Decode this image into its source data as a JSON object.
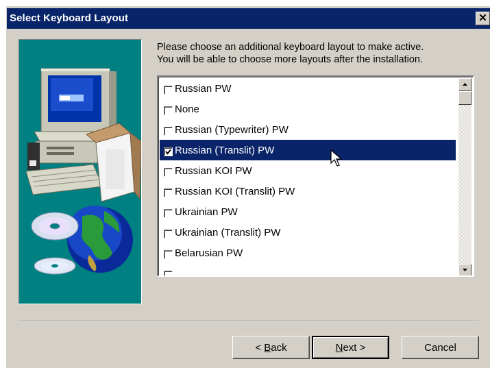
{
  "window": {
    "title": "Select Keyboard Layout",
    "close_glyph": "✕"
  },
  "instructions": {
    "line1": "Please choose an additional keyboard layout to make active.",
    "line2": "You will be able to choose more layouts after the installation."
  },
  "layouts": [
    {
      "label": "Russian PW",
      "checked": false,
      "selected": false
    },
    {
      "label": "None",
      "checked": false,
      "selected": false
    },
    {
      "label": "Russian (Typewriter) PW",
      "checked": false,
      "selected": false
    },
    {
      "label": "Russian (Translit) PW",
      "checked": true,
      "selected": true
    },
    {
      "label": "Russian KOI PW",
      "checked": false,
      "selected": false
    },
    {
      "label": "Russian KOI (Translit) PW",
      "checked": false,
      "selected": false
    },
    {
      "label": "Ukrainian PW",
      "checked": false,
      "selected": false
    },
    {
      "label": "Ukrainian (Translit) PW",
      "checked": false,
      "selected": false
    },
    {
      "label": "Belarusian PW",
      "checked": false,
      "selected": false
    },
    {
      "label": "",
      "checked": false,
      "selected": false
    }
  ],
  "buttons": {
    "back": {
      "prefix": "< ",
      "accel": "B",
      "rest": "ack"
    },
    "next": {
      "accel": "N",
      "rest": "ext >"
    },
    "cancel": "Cancel"
  },
  "icons": {
    "art": "computer-globe-cd-illustration",
    "scroll_up": "arrow-up-icon",
    "scroll_down": "arrow-down-icon",
    "pointer": "mouse-pointer-icon",
    "check": "checkmark-icon"
  },
  "colors": {
    "titlebar": "#0a246a",
    "face": "#d4d0c8",
    "art_bg": "#008080",
    "selection": "#0a246a"
  }
}
